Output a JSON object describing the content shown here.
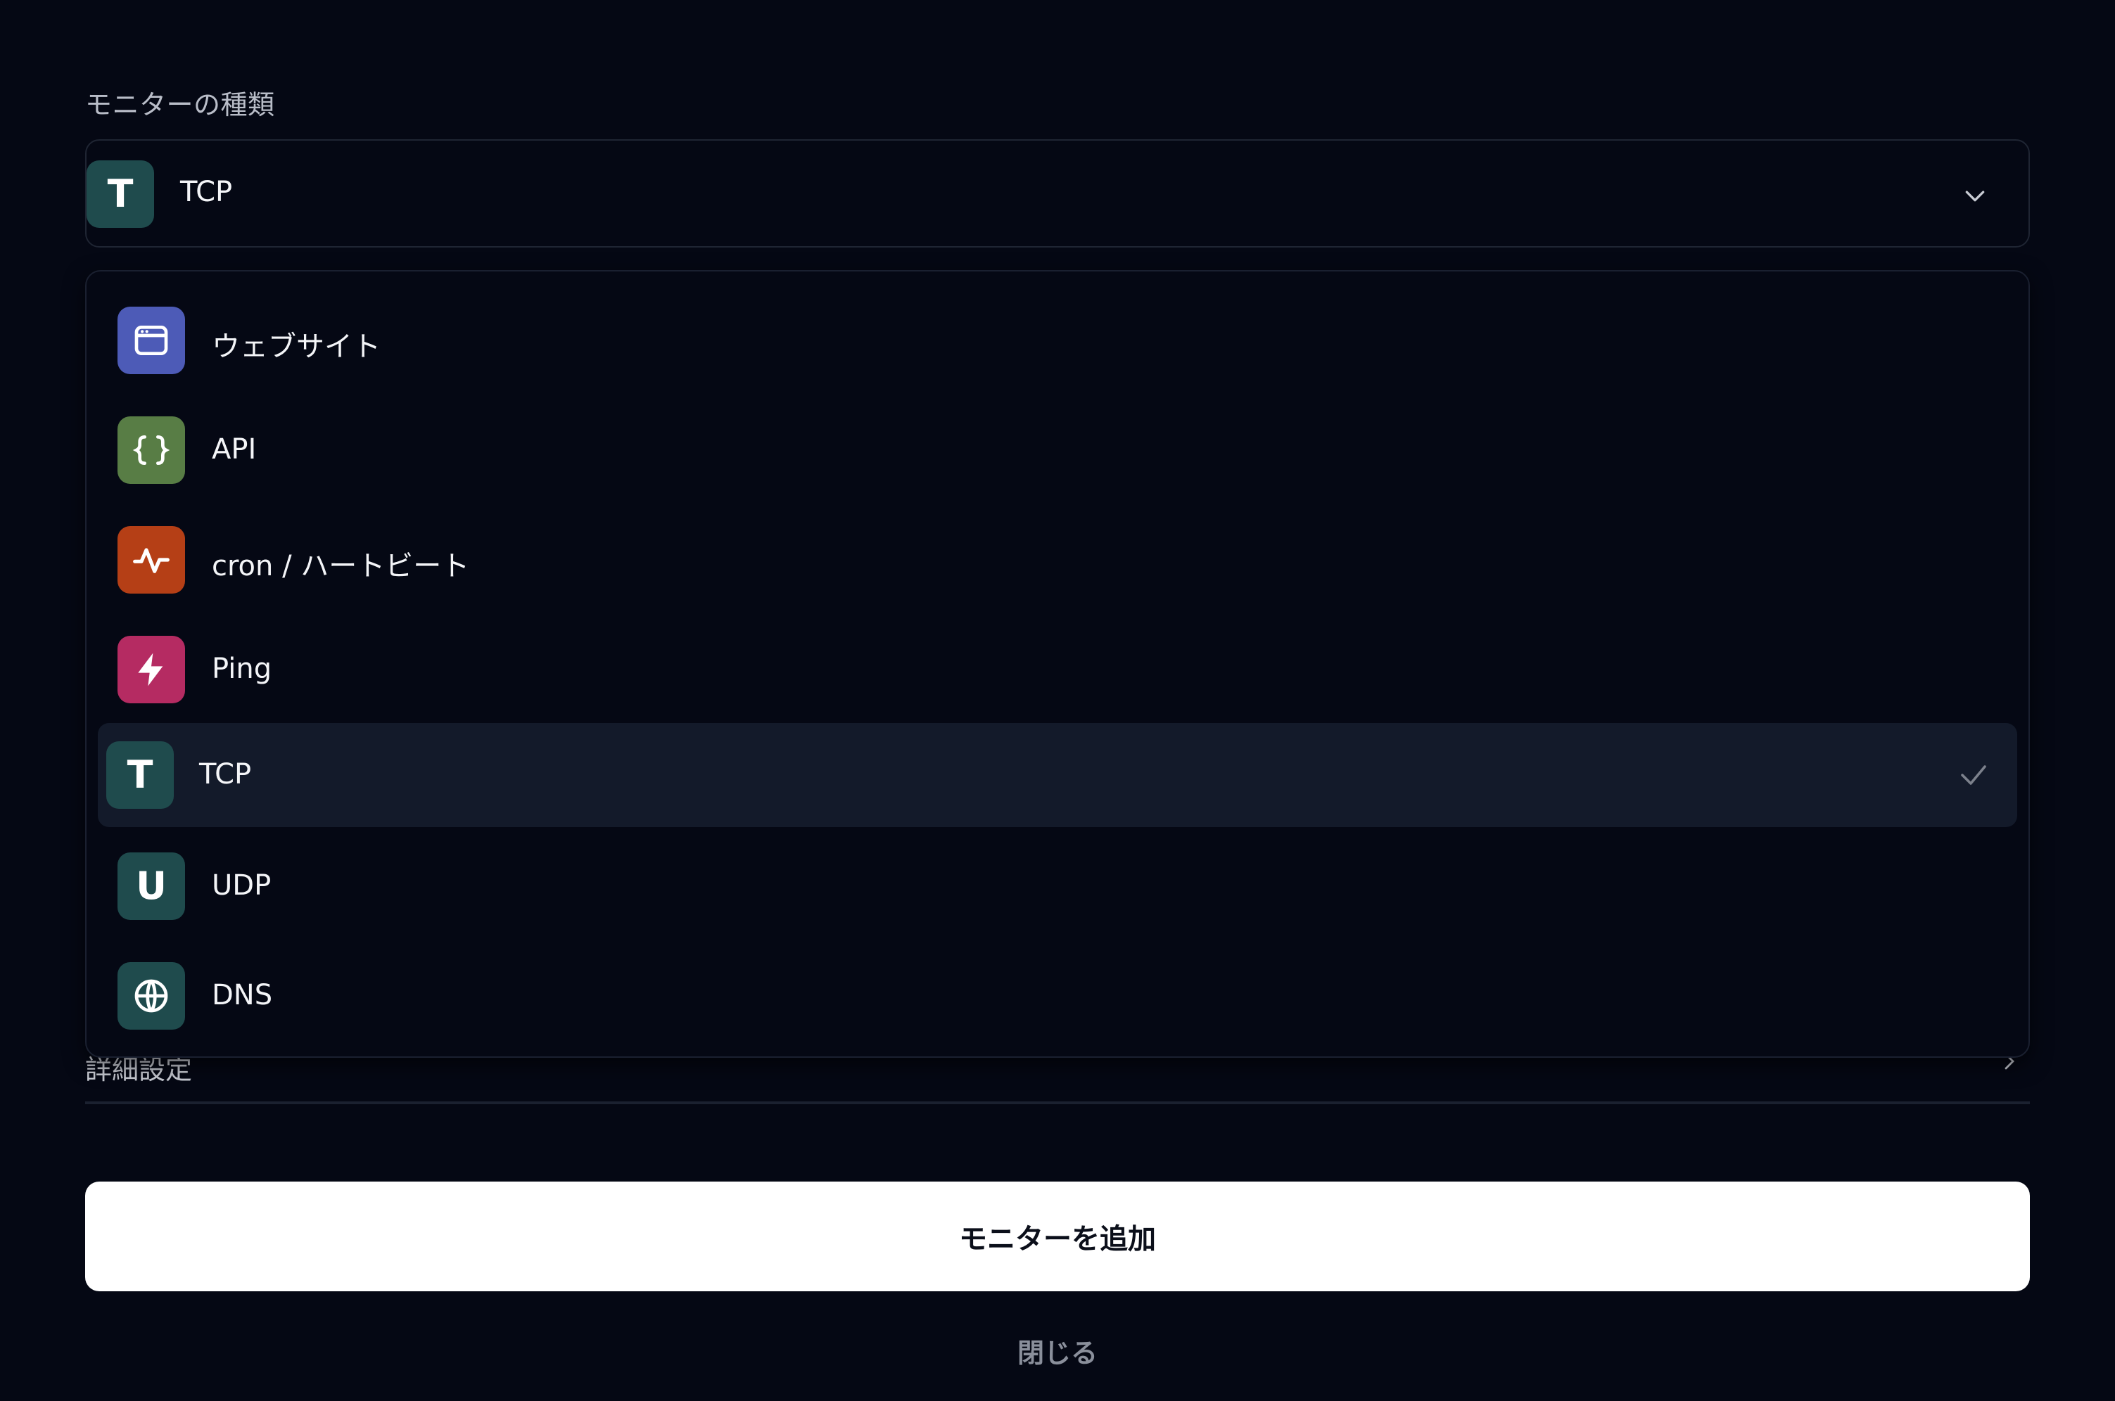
{
  "section_label": "モニターの種類",
  "select": {
    "value_label": "TCP",
    "badge_letter": "T",
    "badge_color": "#1f4b4d"
  },
  "options": [
    {
      "label": "ウェブサイト",
      "icon": "browser-window-icon",
      "color": "#4d5bb7",
      "selected": false
    },
    {
      "label": "API",
      "icon": "curly-braces-icon",
      "color": "#587d45",
      "selected": false
    },
    {
      "label": "cron / ハートビート",
      "icon": "pulse-activity-icon",
      "color": "#b53f16",
      "selected": false
    },
    {
      "label": "Ping",
      "icon": "lightning-bolt-icon",
      "color": "#b52b62",
      "selected": false
    },
    {
      "label": "TCP",
      "icon": "letter-t-icon",
      "letter": "T",
      "color": "#1f4b4d",
      "selected": true
    },
    {
      "label": "UDP",
      "icon": "letter-u-icon",
      "letter": "U",
      "color": "#1f4b4d",
      "selected": false
    },
    {
      "label": "DNS",
      "icon": "globe-icon",
      "color": "#1f4b4d",
      "selected": false
    }
  ],
  "advanced_settings_label": "詳細設定",
  "add_button_label": "モニターを追加",
  "close_button_label": "閉じる"
}
